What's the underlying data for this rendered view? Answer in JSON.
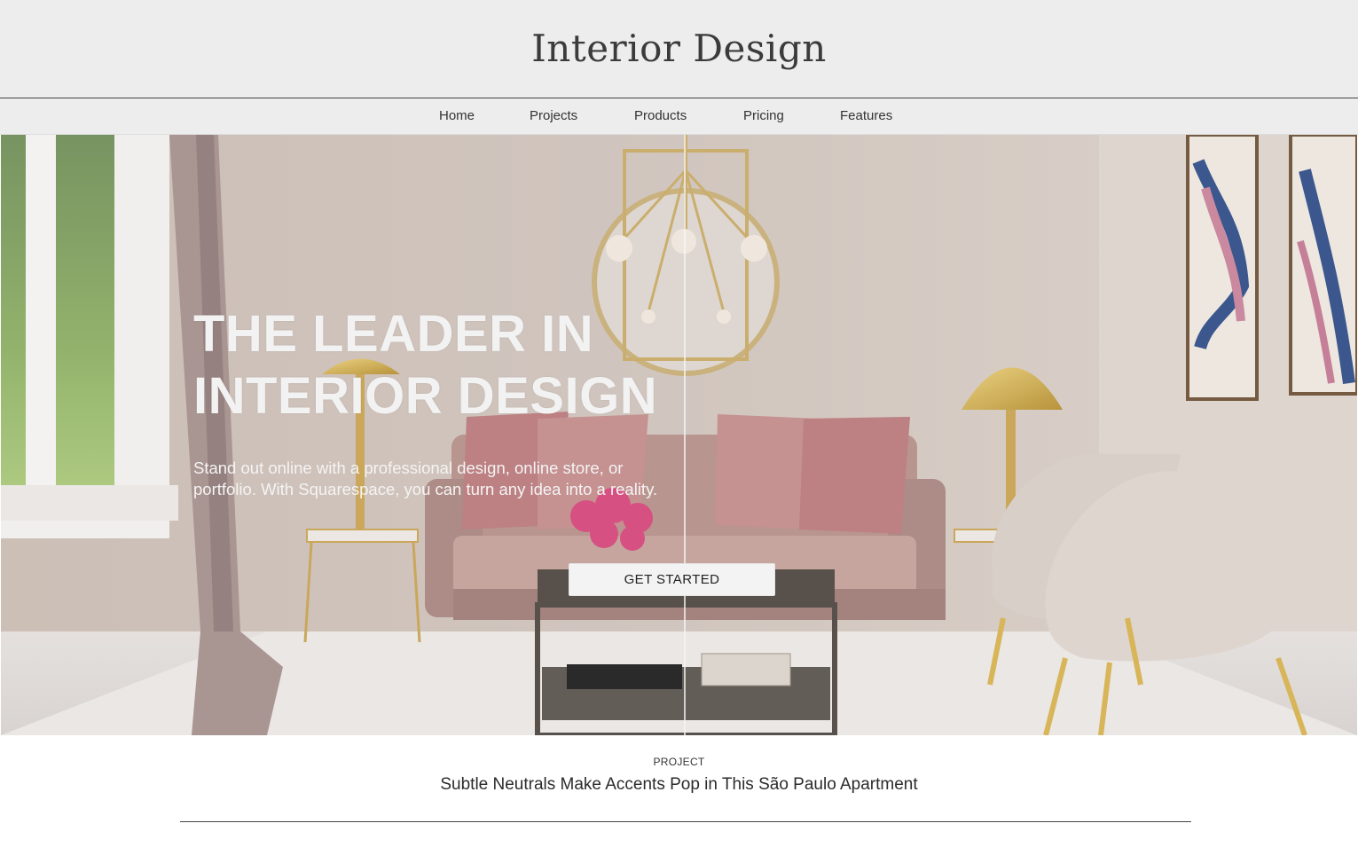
{
  "header": {
    "title": "Interior Design"
  },
  "nav": {
    "items": [
      {
        "label": "Home"
      },
      {
        "label": "Projects"
      },
      {
        "label": "Products"
      },
      {
        "label": "Pricing"
      },
      {
        "label": "Features"
      }
    ]
  },
  "hero": {
    "heading_line1": "THE LEADER IN",
    "heading_line2": "INTERIOR DESIGN",
    "subtext": "Stand out online with a professional design, online store, or portfolio. With Squarespace, you can turn any idea into a reality.",
    "cta_label": "GET STARTED",
    "image_description_icon": "living-room-photo"
  },
  "project": {
    "label": "PROJECT",
    "title": "Subtle Neutrals Make Accents Pop in This São Paulo Apartment"
  },
  "colors": {
    "header_bg": "#ededed",
    "text": "#3b3b3b",
    "hero_text": "#f2f2f2",
    "button_bg": "#f3f3f3"
  }
}
